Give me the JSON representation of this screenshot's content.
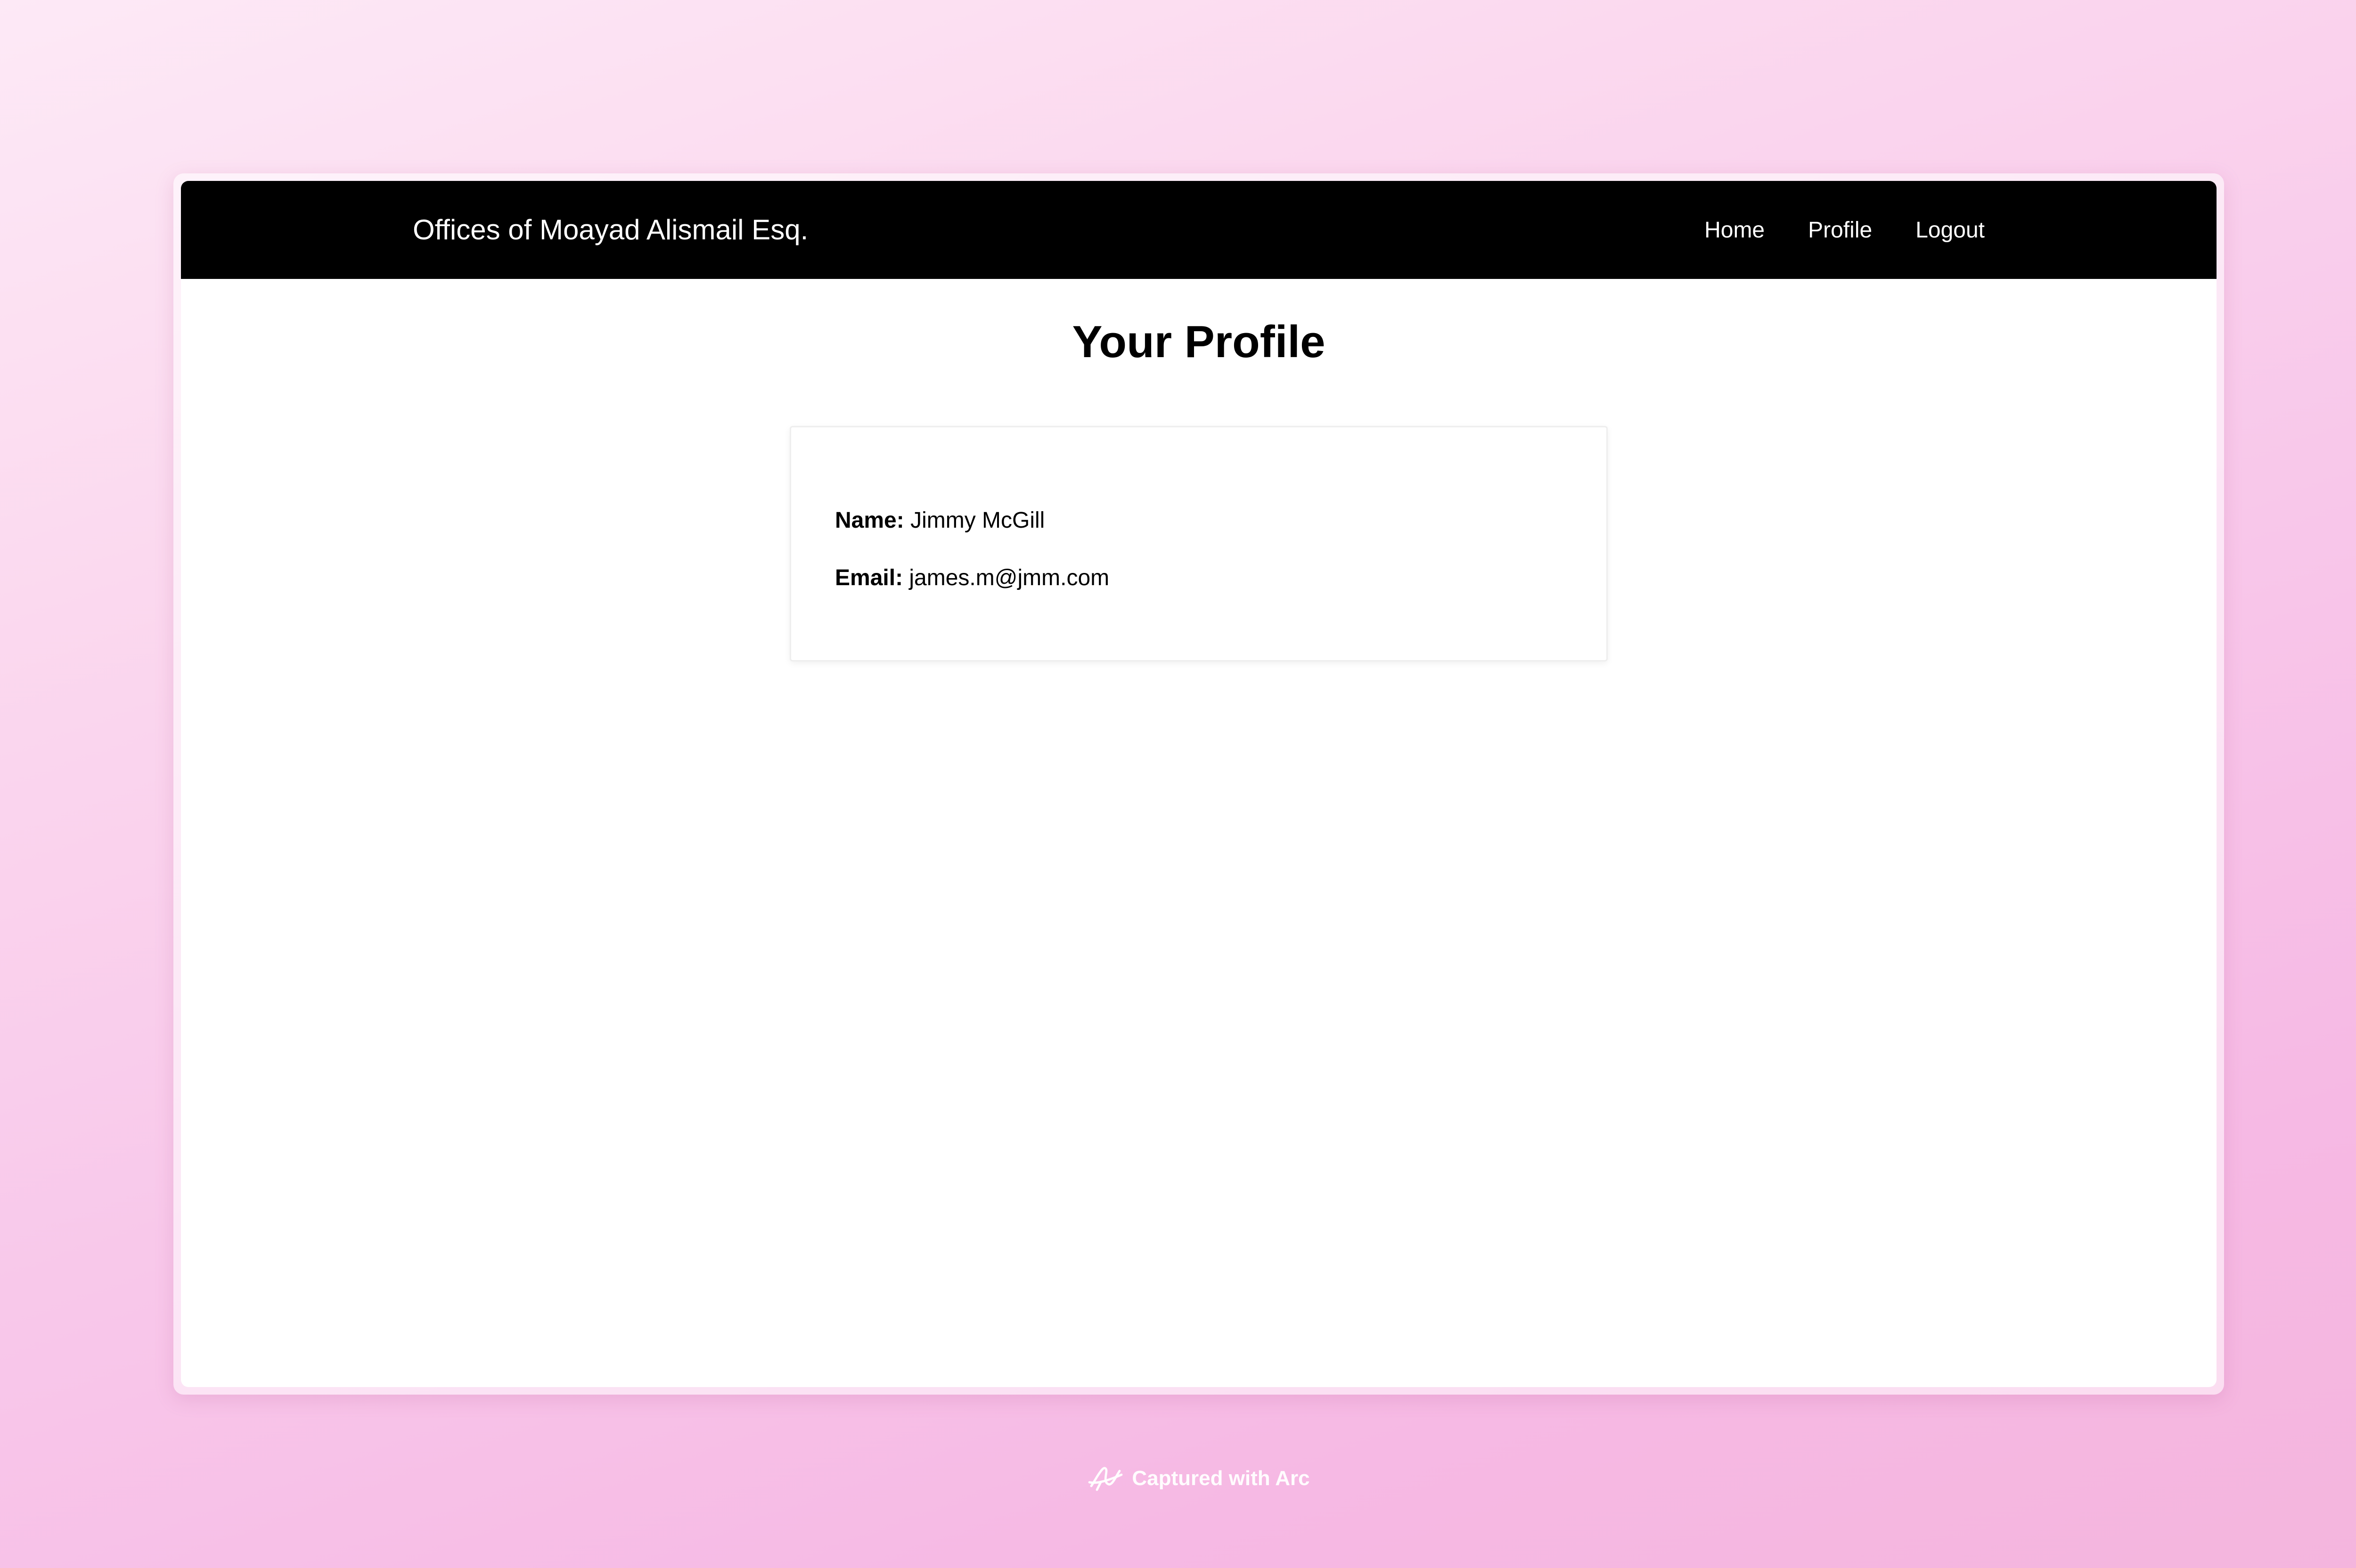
{
  "navbar": {
    "brand": "Offices of Moayad Alismail Esq.",
    "links": [
      "Home",
      "Profile",
      "Logout"
    ]
  },
  "page": {
    "title": "Your Profile"
  },
  "profile": {
    "name_label": "Name:",
    "name_value": "Jimmy McGill",
    "email_label": "Email:",
    "email_value": "james.m@jmm.com"
  },
  "footer": {
    "capture_text": "Captured with Arc",
    "icon": "arc-logo-icon"
  },
  "colors": {
    "navbar_bg": "#000000",
    "navbar_text": "#ffffff",
    "page_bg": "#ffffff",
    "background_gradient": [
      "#fde9f6",
      "#f6b9e4"
    ]
  }
}
